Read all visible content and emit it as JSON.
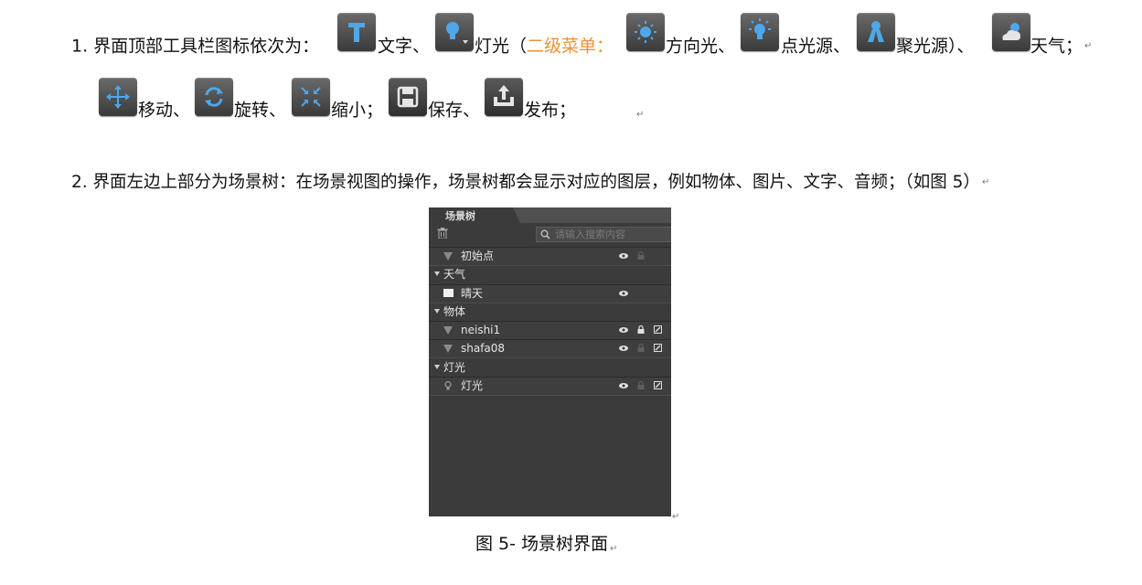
{
  "para1": {
    "intro": "1. 界面顶部工具栏图标依次为：",
    "text_label": "文字、",
    "light_label": "灯光（",
    "submenu_label": "二级菜单：",
    "dir_light_label": "方向光、",
    "point_light_label": "点光源、",
    "spot_light_label": "聚光源）、",
    "weather_label": "天气；",
    "move_label": "移动、",
    "rotate_label": "旋转、",
    "scale_label": "缩小；",
    "save_label": "保存、",
    "publish_label": "发布；",
    "return_mark": "↵"
  },
  "para2": {
    "text": "2. 界面左边上部分为场景树：在场景视图的操作，场景树都会显示对应的图层，例如物体、图片、文字、音频；（如图 5）"
  },
  "panel": {
    "tab_title": "场景树",
    "search_placeholder": "请输入搜索内容",
    "rows": [
      {
        "label": "初始点",
        "kind": "item",
        "icon": "triangle-icon"
      },
      {
        "label": "天气",
        "kind": "group"
      },
      {
        "label": "晴天",
        "kind": "item",
        "icon": "square-icon"
      },
      {
        "label": "物体",
        "kind": "group"
      },
      {
        "label": "neishi1",
        "kind": "item",
        "icon": "triangle-icon"
      },
      {
        "label": "shafa08",
        "kind": "item",
        "icon": "triangle-icon"
      },
      {
        "label": "灯光",
        "kind": "group"
      },
      {
        "label": "灯光",
        "kind": "item",
        "icon": "bulb-icon"
      }
    ]
  },
  "caption": "图 5-  场景树界面",
  "colors": {
    "accent_orange": "#e89433",
    "icon_blue": "#4ea7e8",
    "panel_bg": "#3b3b3b"
  }
}
